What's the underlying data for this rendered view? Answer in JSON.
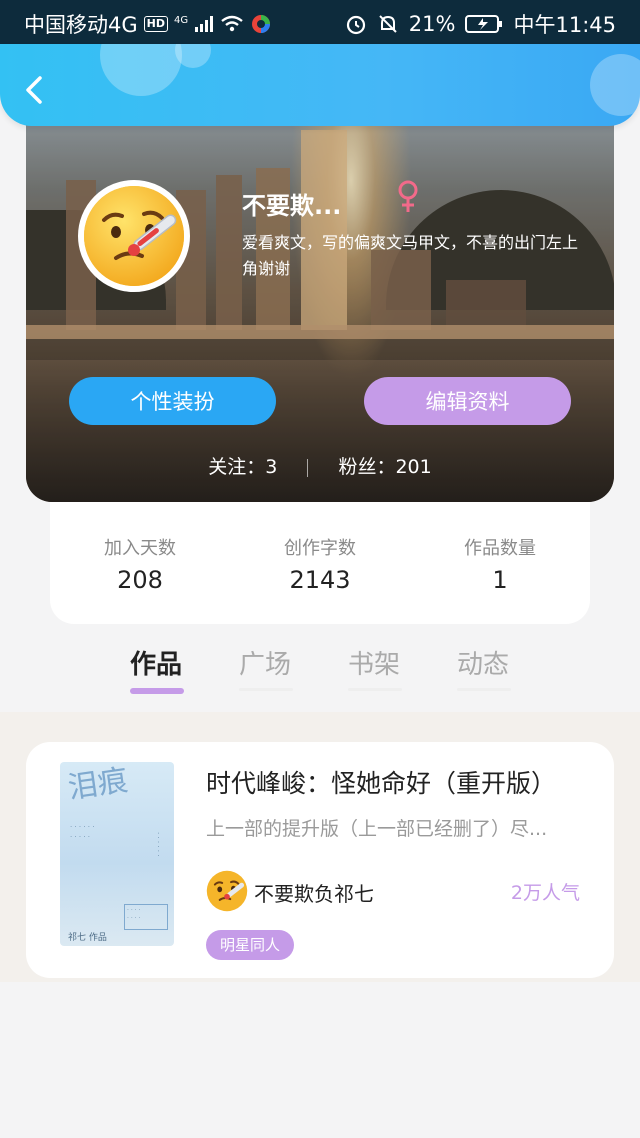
{
  "status_bar": {
    "carrier": "中国移动4G",
    "hd": "HD",
    "net_label": "4G",
    "battery_pct": "21%",
    "time": "中午11:45"
  },
  "profile": {
    "username": "不要欺...",
    "bio": "爱看爽文，写的偏爽文马甲文，不喜的出门左上角谢谢",
    "dress_button": "个性装扮",
    "edit_button": "编辑资料",
    "following_label": "关注：",
    "following_count": "3",
    "fans_label": "粉丝：",
    "fans_count": "201"
  },
  "stats": [
    {
      "label": "加入天数",
      "value": "208"
    },
    {
      "label": "创作字数",
      "value": "2143"
    },
    {
      "label": "作品数量",
      "value": "1"
    }
  ],
  "tabs": [
    {
      "label": "作品",
      "active": true
    },
    {
      "label": "广场",
      "active": false
    },
    {
      "label": "书架",
      "active": false
    },
    {
      "label": "动态",
      "active": false
    }
  ],
  "work": {
    "title": "时代峰峻：怪她命好（重开版）",
    "description": "上一部的提升版（上一部已经删了）尽...",
    "author": "不要欺负祁七",
    "popularity": "2万人气",
    "tag": "明星同人",
    "cover": {
      "title_chars": "泪痕",
      "author": "祁七 作品"
    }
  },
  "colors": {
    "header_blue": "#33c1f3",
    "primary_blue": "#2aa7f4",
    "accent_purple": "#c59be8"
  }
}
